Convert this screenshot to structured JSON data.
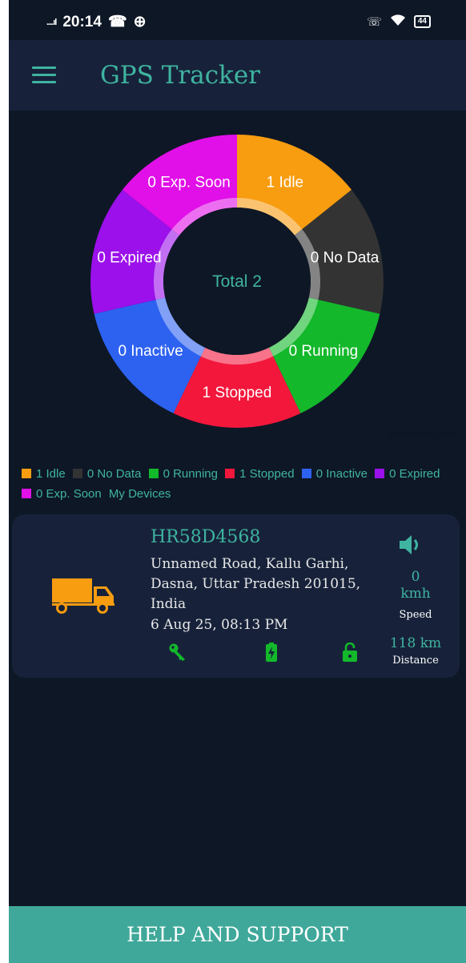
{
  "status_bar": {
    "time": "20:14",
    "signal": "....ıl",
    "battery": "44"
  },
  "app_bar": {
    "title": "GPS Tracker",
    "menu_icon": "hamburger-menu-icon"
  },
  "chart_data": {
    "type": "pie",
    "center_label": "Total 2",
    "slices": [
      {
        "label": "Idle",
        "value": 1,
        "display": "1  Idle",
        "color": "#f89c10"
      },
      {
        "label": "No Data",
        "value": 0,
        "display": "0  No Data",
        "color": "#333333"
      },
      {
        "label": "Running",
        "value": 0,
        "display": "0  Running",
        "color": "#13b82b"
      },
      {
        "label": "Stopped",
        "value": 1,
        "display": "1  Stopped",
        "color": "#f3173c"
      },
      {
        "label": "Inactive",
        "value": 0,
        "display": "0  Inactive",
        "color": "#2d62f1"
      },
      {
        "label": "Expired",
        "value": 0,
        "display": "0  Expired",
        "color": "#9b10eb"
      },
      {
        "label": "Exp. Soon",
        "value": 0,
        "display": "0  Exp. Soon",
        "color": "#e10fe8"
      }
    ],
    "description": "Description Label"
  },
  "legend": [
    {
      "text": "1  Idle",
      "color": "#f89c10"
    },
    {
      "text": "0  No Data",
      "color": "#333333"
    },
    {
      "text": "0  Running",
      "color": "#13b82b"
    },
    {
      "text": "1  Stopped",
      "color": "#f3173c"
    },
    {
      "text": "0  Inactive",
      "color": "#2d62f1"
    },
    {
      "text": "0  Expired",
      "color": "#9b10eb"
    },
    {
      "text": "0  Exp. Soon",
      "color": "#e10fe8"
    }
  ],
  "my_devices_label": "My Devices",
  "device": {
    "plate": "HR58D4568",
    "address": "Unnamed Road, Kallu Garhi, Dasna, Uttar Pradesh 201015, India",
    "datetime": "6 Aug 25, 08:13 PM",
    "speed_value": "0",
    "speed_unit": "kmh",
    "speed_label": "Speed",
    "distance_value": "118 km",
    "distance_label": "Distance",
    "status_icons": [
      "key-icon",
      "battery-charging-icon",
      "unlock-icon"
    ],
    "vehicle_icon": "truck-icon",
    "sound_icon": "volume-icon"
  },
  "help_button": "HELP AND SUPPORT"
}
